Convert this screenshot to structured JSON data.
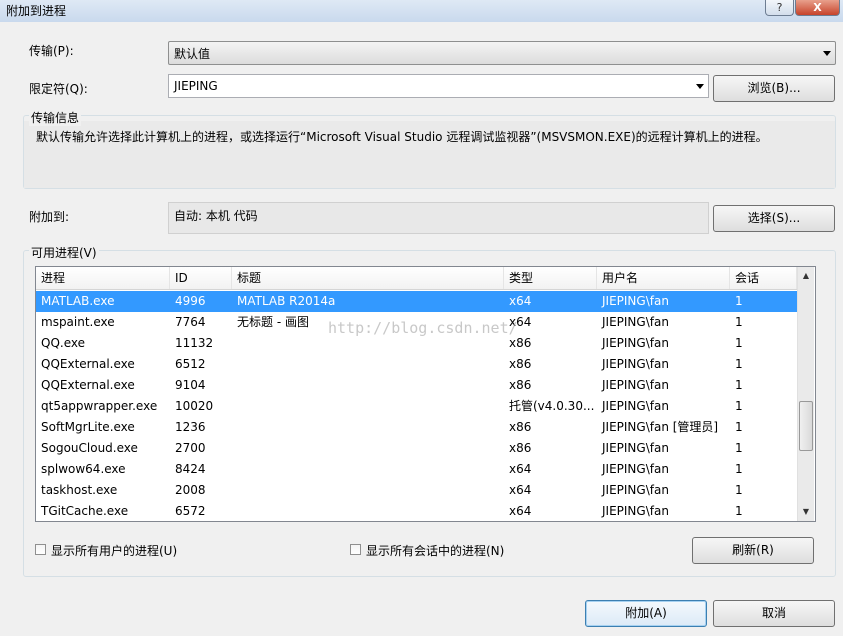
{
  "window": {
    "title": "附加到进程",
    "help_btn": "?",
    "close_btn": "X"
  },
  "transport": {
    "label": "传输(P):",
    "value": "默认值"
  },
  "qualifier": {
    "label": "限定符(Q):",
    "value": "JIEPING",
    "browse_button": "浏览(B)..."
  },
  "transport_info": {
    "title": "传输信息",
    "text": "默认传输允许选择此计算机上的进程，或选择运行“Microsoft Visual Studio 远程调试监视器”(MSVSMON.EXE)的远程计算机上的进程。"
  },
  "attach_to": {
    "label": "附加到:",
    "value": "自动: 本机 代码",
    "select_button": "选择(S)..."
  },
  "processes": {
    "title": "可用进程(V)",
    "columns": [
      "进程",
      "ID",
      "标题",
      "类型",
      "用户名",
      "会话"
    ],
    "rows": [
      [
        "MATLAB.exe",
        "4996",
        "MATLAB R2014a",
        "x64",
        "JIEPING\\fan",
        "1"
      ],
      [
        "mspaint.exe",
        "7764",
        "无标题 - 画图",
        "x64",
        "JIEPING\\fan",
        "1"
      ],
      [
        "QQ.exe",
        "11132",
        "",
        "x86",
        "JIEPING\\fan",
        "1"
      ],
      [
        "QQExternal.exe",
        "6512",
        "",
        "x86",
        "JIEPING\\fan",
        "1"
      ],
      [
        "QQExternal.exe",
        "9104",
        "",
        "x86",
        "JIEPING\\fan",
        "1"
      ],
      [
        "qt5appwrapper.exe",
        "10020",
        "",
        "托管(v4.0.30...",
        "JIEPING\\fan",
        "1"
      ],
      [
        "SoftMgrLite.exe",
        "1236",
        "",
        "x86",
        "JIEPING\\fan [管理员]",
        "1"
      ],
      [
        "SogouCloud.exe",
        "2700",
        "",
        "x86",
        "JIEPING\\fan",
        "1"
      ],
      [
        "splwow64.exe",
        "8424",
        "",
        "x64",
        "JIEPING\\fan",
        "1"
      ],
      [
        "taskhost.exe",
        "2008",
        "",
        "x64",
        "JIEPING\\fan",
        "1"
      ],
      [
        "TGitCache.exe",
        "6572",
        "",
        "x64",
        "JIEPING\\fan",
        "1"
      ]
    ],
    "selected_index": 0,
    "show_all_users": "显示所有用户的进程(U)",
    "show_all_sessions": "显示所有会话中的进程(N)",
    "refresh_button": "刷新(R)"
  },
  "watermark": "http://blog.csdn.net/",
  "footer": {
    "attach_button": "附加(A)",
    "cancel_button": "取消"
  },
  "colors": {
    "selection": "#3399ff",
    "dialog_bg": "#f0f0f0"
  }
}
